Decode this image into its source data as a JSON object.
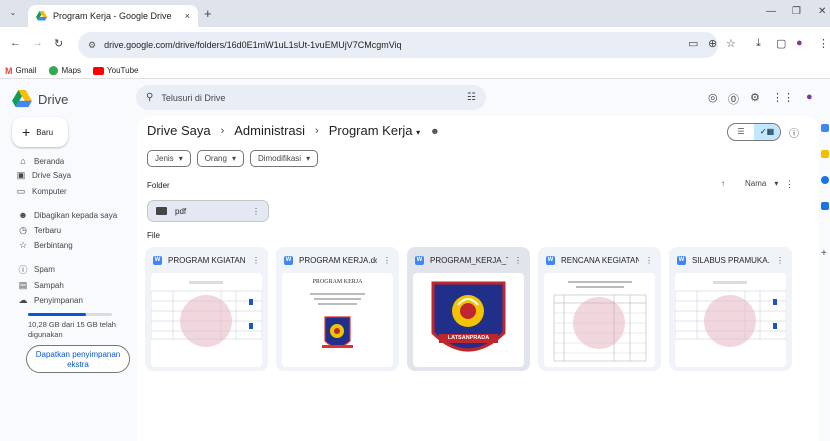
{
  "browser": {
    "tab_title": "Program Kerja - Google Drive",
    "tab_close": "×",
    "new_tab": "+",
    "url": "drive.google.com/drive/folders/16d0E1mW1uL1sUt-1vuEMUjV7CMcgmViq",
    "bookmarks": [
      {
        "label": "Gmail",
        "color": "#ea4335"
      },
      {
        "label": "Maps",
        "color": "#34a853"
      },
      {
        "label": "YouTube",
        "color": "#ff0000"
      }
    ]
  },
  "drive": {
    "app_name": "Drive",
    "search_placeholder": "Telusuri di Drive",
    "new_label": "Baru",
    "nav": [
      {
        "label": "Beranda",
        "icon": "home-icon"
      },
      {
        "label": "Drive Saya",
        "icon": "my-drive-icon"
      },
      {
        "label": "Komputer",
        "icon": "computer-icon"
      },
      {
        "label": "Dibagikan kepada saya",
        "icon": "shared-icon"
      },
      {
        "label": "Terbaru",
        "icon": "clock-icon"
      },
      {
        "label": "Berbintang",
        "icon": "star-icon"
      },
      {
        "label": "Spam",
        "icon": "spam-icon"
      },
      {
        "label": "Sampah",
        "icon": "trash-icon"
      },
      {
        "label": "Penyimpanan",
        "icon": "cloud-icon"
      }
    ],
    "storage": {
      "text": "10,28 GB dari 15 GB telah digunakan",
      "fraction": 0.685,
      "cta": "Dapatkan penyimpanan ekstra"
    }
  },
  "main": {
    "breadcrumb": [
      "Drive Saya",
      "Administrasi",
      "Program Kerja"
    ],
    "filters": [
      "Jenis",
      "Orang",
      "Dimodifikasi"
    ],
    "folder_section": "Folder",
    "file_section": "File",
    "sort_label": "Nama",
    "folder": {
      "name": "pdf"
    },
    "files": [
      {
        "name": "PROGRAM KGIATAN ...",
        "thumb": "table"
      },
      {
        "name": "PROGRAM KERJA.doc",
        "thumb": "cover",
        "doc_title": "PROGRAM KERJA"
      },
      {
        "name": "PROGRAM_KERJA_T...",
        "thumb": "logo",
        "logo_text": "LATSANPRADA"
      },
      {
        "name": "RENCANA KEGIATAN...",
        "thumb": "doc"
      },
      {
        "name": "SILABUS PRAMUKA...",
        "thumb": "table"
      }
    ]
  },
  "colors": {
    "accent": "#0b57d0",
    "selected": "#c2e7ff",
    "word": "#4285f4"
  }
}
